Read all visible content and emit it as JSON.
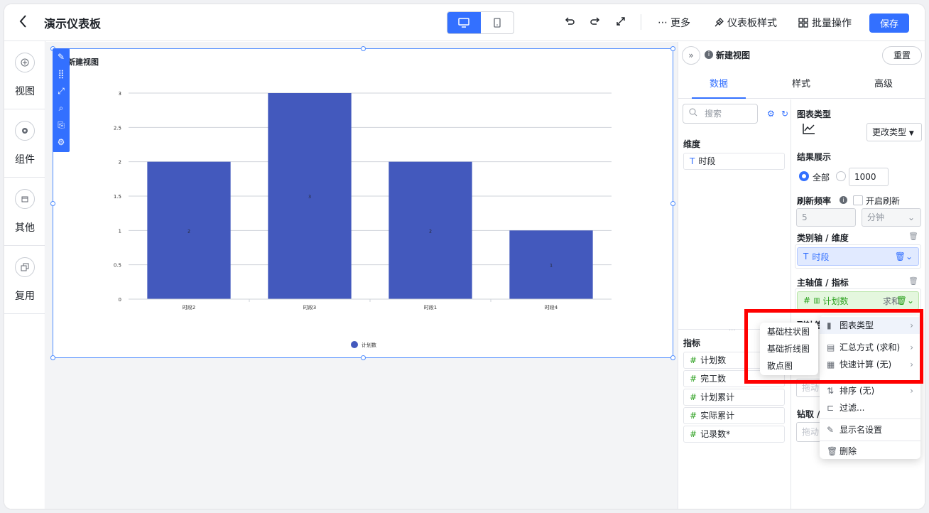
{
  "header": {
    "title": "演示仪表板",
    "toolbar": {
      "more": "更多",
      "dashboard_style": "仪表板样式",
      "batch": "批量操作",
      "save": "保存"
    }
  },
  "left_nav": [
    {
      "label": "视图",
      "icon": "plus-circle-icon"
    },
    {
      "label": "组件",
      "icon": "gear-icon"
    },
    {
      "label": "其他",
      "icon": "box-icon"
    },
    {
      "label": "复用",
      "icon": "copy-icon"
    }
  ],
  "chart_title": "新建视图",
  "chart_data": {
    "type": "bar",
    "categories": [
      "时段2",
      "时段3",
      "时段1",
      "时段4"
    ],
    "series": [
      {
        "name": "计划数",
        "values": [
          2,
          3,
          2,
          1
        ]
      }
    ],
    "yticks": [
      "0",
      "0.5",
      "1",
      "1.5",
      "2",
      "2.5",
      "3"
    ],
    "ylim": [
      0,
      3
    ],
    "grid": true,
    "legend": "bottom",
    "color": "#4359bd"
  },
  "panel": {
    "view_name": "新建视图",
    "reset": "重置",
    "tabs": [
      "数据",
      "样式",
      "高级"
    ],
    "search_placeholder": "搜索",
    "dimension_label": "维度",
    "dimensions": [
      "时段"
    ],
    "metric_label": "指标",
    "metrics": [
      "计划数",
      "完工数",
      "计划累计",
      "实际累计",
      "记录数*"
    ],
    "chart_type_label": "图表类型",
    "change_type": "更改类型",
    "result_label": "结果展示",
    "result_all": "全部",
    "result_limit": "1000",
    "refresh_label": "刷新频率",
    "refresh_toggle": "开启刷新",
    "refresh_value": "5",
    "refresh_unit": "分钟",
    "category_axis_label": "类别轴 / 维度",
    "category_field": "时段",
    "main_axis_label": "主轴值 / 指标",
    "main_field": "计划数",
    "main_agg": "求和",
    "secondary_label": "副轴值",
    "drill_label": "钻取 /",
    "drag_hint": "拖动"
  },
  "context_menu": {
    "items": [
      "图表类型",
      "汇总方式 (求和)",
      "快速计算 (无)",
      "排序 (无)",
      "过滤...",
      "显示名设置",
      "删除"
    ]
  },
  "submenu": {
    "items": [
      "基础柱状图",
      "基础折线图",
      "散点图"
    ]
  }
}
